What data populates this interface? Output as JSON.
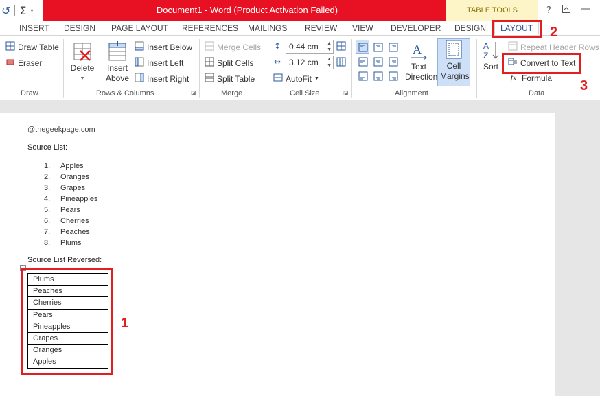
{
  "titlebar": {
    "title": "Document1 -  Word (Product Activation Failed)",
    "table_tools": "TABLE TOOLS",
    "help": "?",
    "qat": {
      "undo": "↺",
      "sum": "Σ",
      "dropdown": "▾"
    }
  },
  "tabs": [
    "INSERT",
    "DESIGN",
    "PAGE LAYOUT",
    "REFERENCES",
    "MAILINGS",
    "REVIEW",
    "VIEW",
    "DEVELOPER",
    "DESIGN",
    "LAYOUT"
  ],
  "ribbon": {
    "draw": {
      "draw_table": "Draw Table",
      "eraser": "Eraser",
      "label": "Draw"
    },
    "rows_columns": {
      "delete": "Delete",
      "insert_above": "Insert Above",
      "insert_below": "Insert Below",
      "insert_left": "Insert Left",
      "insert_right": "Insert Right",
      "label": "Rows & Columns"
    },
    "merge": {
      "merge_cells": "Merge Cells",
      "split_cells": "Split Cells",
      "split_table": "Split Table",
      "label": "Merge"
    },
    "cell_size": {
      "height": "0.44 cm",
      "width": "3.12 cm",
      "autofit": "AutoFit",
      "label": "Cell Size"
    },
    "alignment": {
      "text_direction": "Text Direction",
      "cell_margins": "Cell Margins",
      "label": "Alignment"
    },
    "data": {
      "sort": "Sort",
      "repeat_header_rows": "Repeat Header Rows",
      "convert_to_text": "Convert to Text",
      "formula": "Formula",
      "label": "Data"
    }
  },
  "document": {
    "watermark": "@thegeekpage.com",
    "source_list_label": "Source List:",
    "source_list": [
      "Apples",
      "Oranges",
      "Grapes",
      "Pineapples",
      "Pears",
      "Cherries",
      "Peaches",
      "Plums"
    ],
    "reversed_label": "Source List Reversed:",
    "table_rows": [
      "Plums",
      "Peaches",
      "Cherries",
      "Pears",
      "Pineapples",
      "Grapes",
      "Oranges",
      "Apples"
    ]
  },
  "annotations": {
    "one": "1",
    "two": "2",
    "three": "3"
  },
  "colors": {
    "title_red": "#e81123",
    "highlight_red": "#e02020",
    "word_blue": "#2b579a",
    "table_tools_bg": "#fdf5c8"
  }
}
